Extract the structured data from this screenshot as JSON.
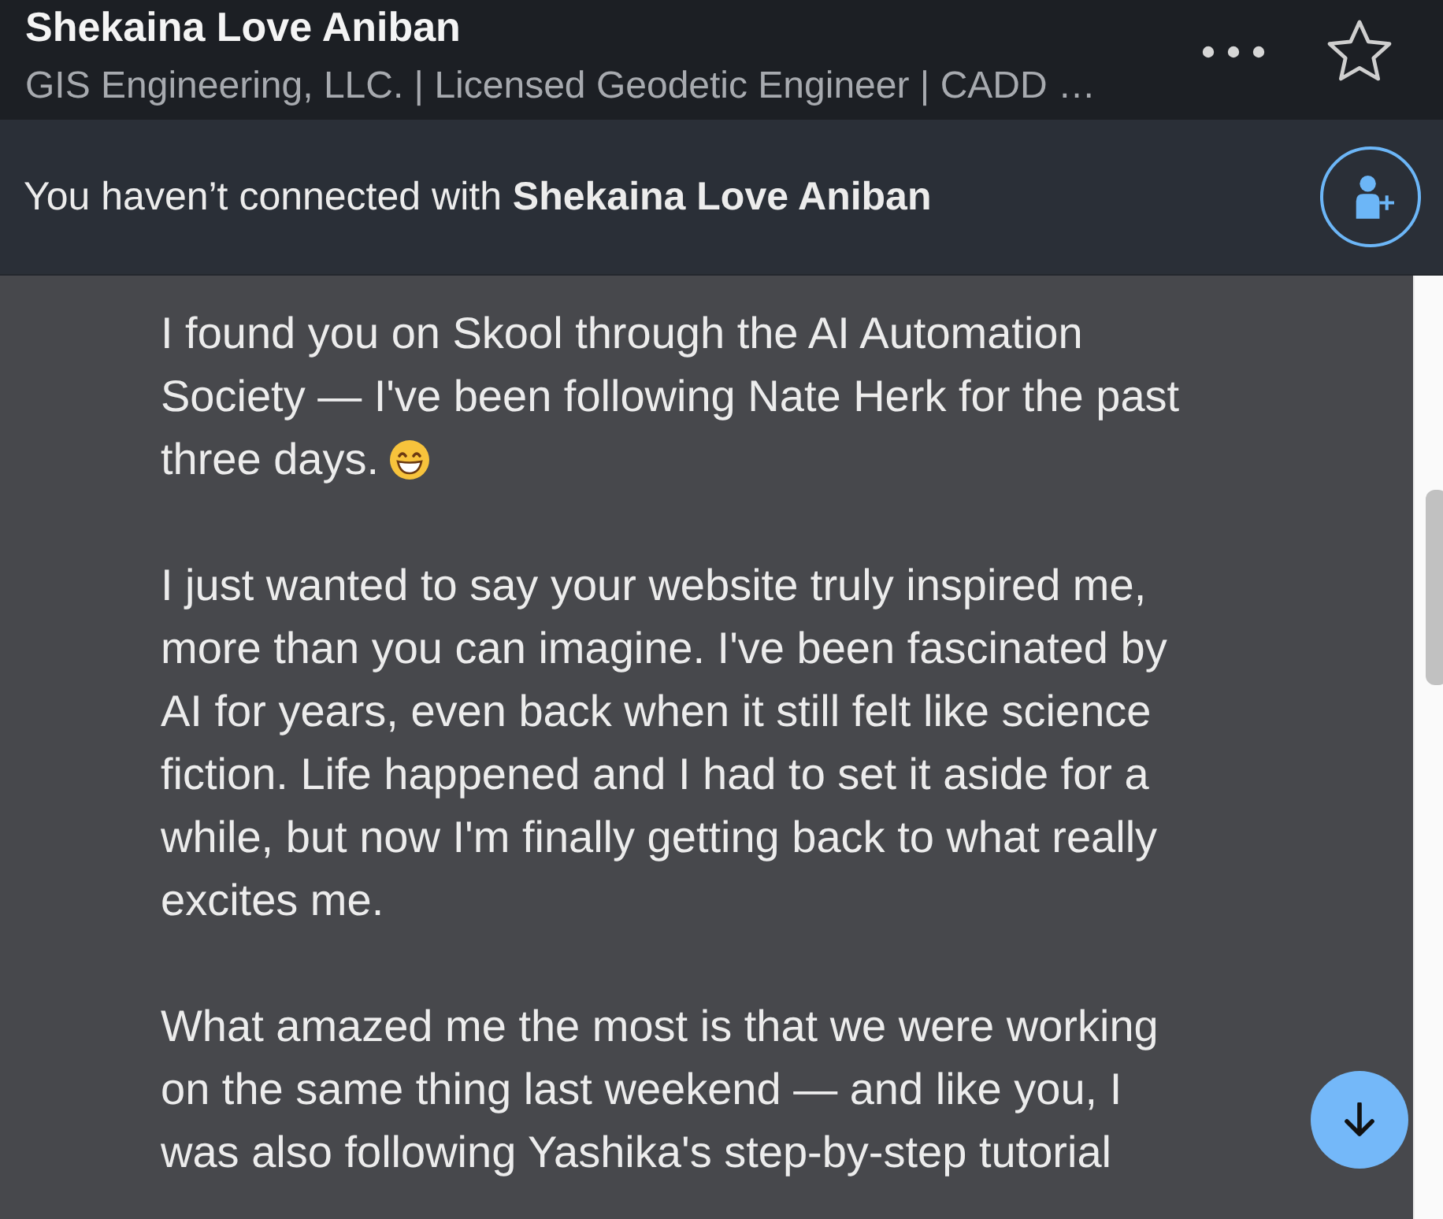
{
  "header": {
    "name": "Shekaina Love Aniban",
    "headline": "GIS Engineering, LLC. | Licensed Geodetic Engineer | CADD …"
  },
  "connection_banner": {
    "text": "You haven’t connected with **Shekaina Love Aniban**"
  },
  "message": {
    "paragraphs": [
      {
        "text": "I found you on Skool through the AI Automation Society — I've been following Nate Herk for the past three days.",
        "emoji": true
      },
      {
        "text": "I just wanted to say your website truly inspired me, more than you can imagine. I've been fascinated by AI for years, even back when it still felt like science fiction. Life happened and I had to set it aside for a while, but now I'm finally getting back to what really excites me.",
        "emoji": false
      },
      {
        "text": "What amazed me the most is that we were working on the same thing last weekend — and like you, I was also following Yashika's step-by-step tutorial",
        "emoji": false
      }
    ]
  }
}
